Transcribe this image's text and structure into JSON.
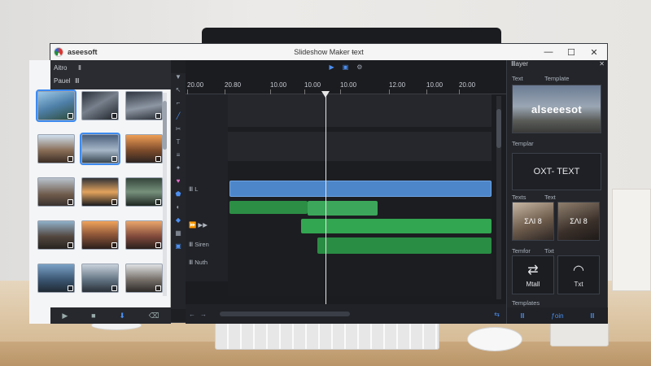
{
  "window": {
    "brand": "aseesoft",
    "title": "Slideshow Maker ŧext",
    "controls": {
      "minimize": "—",
      "maximize": "☐",
      "close": "✕"
    }
  },
  "media_panel": {
    "tabs": [
      "Aitro",
      "Ⅱ"
    ],
    "subtabs": [
      "Pauel",
      "Ⅲ"
    ],
    "footer_icons": [
      "play-icon",
      "stop-icon",
      "import-icon",
      "delete-icon"
    ]
  },
  "timeline": {
    "toolbar_icons": [
      "play-icon",
      "save-icon",
      "settings-icon"
    ],
    "ruler_ticks": [
      "20.00",
      "20.80",
      "10.00",
      "10.00",
      "10.00",
      "12.00",
      "10.00",
      "20.00"
    ],
    "track_labels": [
      "Ⅲ L",
      "⏩ ▶▶",
      "Ⅲ Siren",
      "Ⅲ Nuth"
    ]
  },
  "right_panel": {
    "header": "Ⅲayer",
    "sections": {
      "text": "Text",
      "template": "Template",
      "template2": "Templar",
      "texts": "Texts",
      "text2": "Text",
      "template3": "Temfor",
      "text3": "Tixt",
      "template4": "Templates"
    },
    "preview_text": "alseeesot",
    "text_card": "OXT- TEXT",
    "tiles": {
      "photo1": "ΣΛΙ 8",
      "photo2": "ΣΛΙ 8",
      "icon1_label": "Mtall",
      "icon2_label": "Txt"
    },
    "footer_labels": [
      "Ⅲ",
      "ƒoin",
      "Ⅲ"
    ]
  }
}
